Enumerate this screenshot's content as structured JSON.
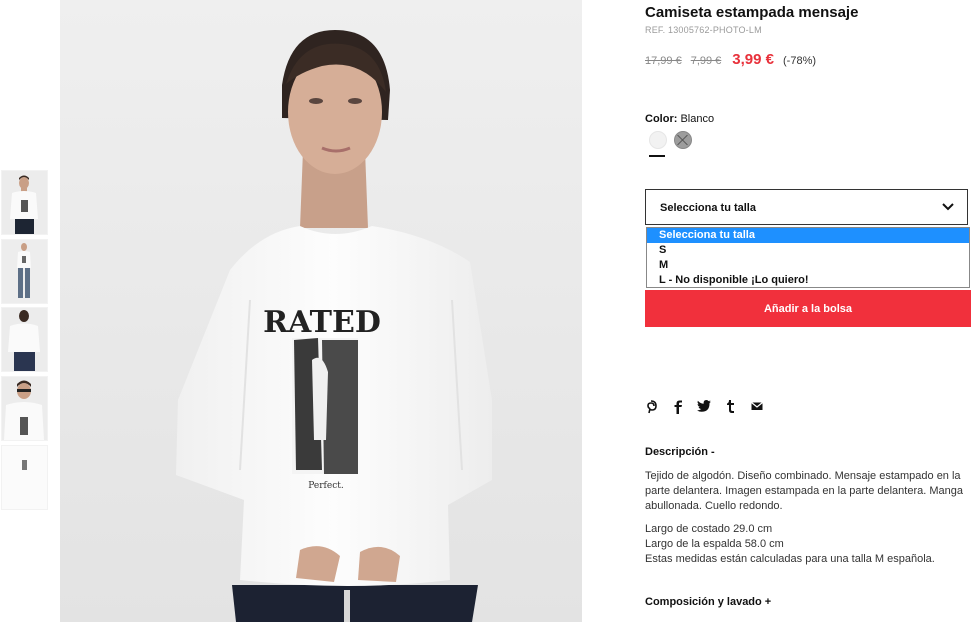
{
  "product": {
    "title": "Camiseta estampada mensaje",
    "ref": "REF. 13005762-PHOTO-LM",
    "price_original": "17,99 €",
    "price_previous": "7,99 €",
    "price_current": "3,99 €",
    "discount": "(-78%)",
    "color_label": "Color:",
    "color_value": "Blanco"
  },
  "size": {
    "placeholder": "Selecciona tu talla",
    "options": [
      "Selecciona tu talla",
      "S",
      "M",
      "L - No disponible ¡Lo quiero!"
    ]
  },
  "actions": {
    "add_to_bag": "Añadir a la bolsa"
  },
  "description": {
    "title": "Descripción -",
    "text": "Tejido de algodón. Diseño combinado. Mensaje estampado en la parte delantera. Imagen estampada en la parte delantera. Manga abullonada. Cuello redondo.",
    "measure_1": "Largo de costado 29.0 cm",
    "measure_2": "Largo de la espalda 58.0 cm",
    "measure_note": "Estas medidas están calculadas para una talla M española."
  },
  "composition": {
    "title": "Composición y lavado +"
  },
  "print": {
    "headline": "RATED",
    "caption": "Perfect."
  },
  "social_icons": [
    "pinterest-icon",
    "facebook-icon",
    "twitter-icon",
    "tumblr-icon",
    "email-icon"
  ],
  "colors": {
    "accent_price": "#e8313b",
    "button": "#f1303c",
    "dropdown_highlight": "#1e90ff"
  }
}
